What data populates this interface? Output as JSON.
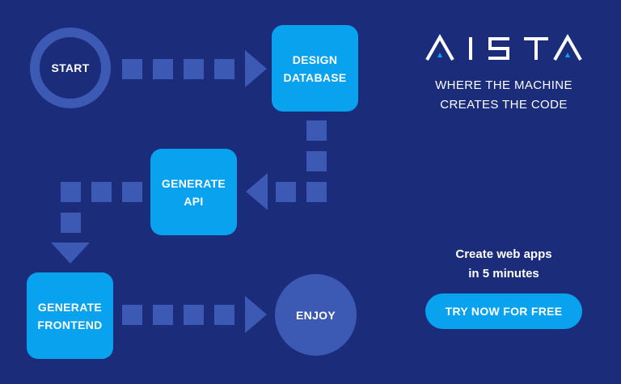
{
  "brand": {
    "name": "AISTA",
    "tagline_line1": "WHERE THE MACHINE",
    "tagline_line2": "CREATES THE CODE"
  },
  "flow": {
    "start": "START",
    "design_line1": "DESIGN",
    "design_line2": "DATABASE",
    "api_line1": "GENERATE",
    "api_line2": "API",
    "frontend_line1": "GENERATE",
    "frontend_line2": "FRONTEND",
    "enjoy": "ENJOY"
  },
  "cta": {
    "text_line1": "Create web apps",
    "text_line2": "in 5 minutes",
    "button_label": "TRY NOW FOR FREE"
  },
  "colors": {
    "background": "#1a2c7a",
    "connector": "#3c59b3",
    "accent": "#08a2ef",
    "text": "#ffffff"
  }
}
